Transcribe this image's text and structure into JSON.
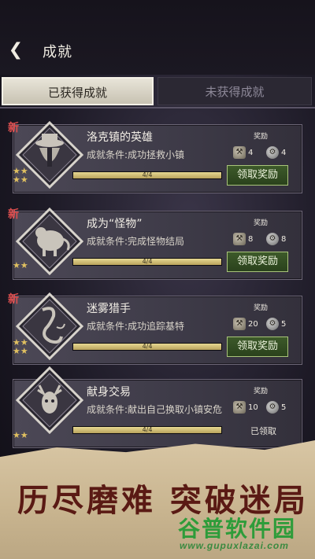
{
  "header": {
    "title": "成就",
    "back_icon": "back-arrow-icon"
  },
  "tabs": [
    {
      "label": "已获得成就",
      "active": true
    },
    {
      "label": "未获得成就",
      "active": false
    }
  ],
  "achievements": [
    {
      "is_new": true,
      "new_label": "新",
      "title": "洛克镇的英雄",
      "condition": "成就条件:成功拯救小镇",
      "stars": 3,
      "progress": "4/4",
      "progress_fraction": 1.0,
      "reward_label": "奖励",
      "reward_a": "4",
      "reward_b": "4",
      "action": "领取奖励",
      "badge_icon": "hat-man-badge-icon"
    },
    {
      "is_new": true,
      "new_label": "新",
      "title": "成为“怪物”",
      "condition": "成就条件:完成怪物结局",
      "stars": 2,
      "progress": "4/4",
      "progress_fraction": 1.0,
      "reward_label": "奖励",
      "reward_a": "8",
      "reward_b": "8",
      "action": "领取奖励",
      "badge_icon": "beast-badge-icon"
    },
    {
      "is_new": true,
      "new_label": "新",
      "title": "迷雾猎手",
      "condition": "成就条件:成功追踪基特",
      "stars": 3,
      "progress": "4/4",
      "progress_fraction": 1.0,
      "reward_label": "奖励",
      "reward_a": "20",
      "reward_b": "5",
      "action": "领取奖励",
      "badge_icon": "serpent-badge-icon"
    },
    {
      "is_new": false,
      "new_label": "",
      "title": "献身交易",
      "condition": "成就条件:献出自己换取小镇安危",
      "stars": 2,
      "progress": "4/4",
      "progress_fraction": 1.0,
      "reward_label": "奖励",
      "reward_a": "10",
      "reward_b": "5",
      "action": "已领取",
      "badge_icon": "deer-skull-badge-icon"
    }
  ],
  "banner": {
    "slogan": "历尽磨难  突破迷局"
  },
  "watermark": {
    "name": "谷普软件园",
    "url": "www.gupuxlazai.com"
  }
}
